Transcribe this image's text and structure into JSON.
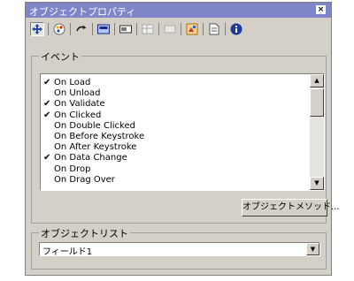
{
  "window": {
    "title": "オブジェクトプロパティ",
    "close_glyph": "×"
  },
  "toolbar": {
    "icons": [
      {
        "name": "move-arrows-icon",
        "active": true
      },
      {
        "name": "color-palette-icon"
      },
      {
        "name": "curved-arrow-icon"
      },
      {
        "name": "picture-icon"
      },
      {
        "name": "text-field-icon"
      },
      {
        "name": "table-icon"
      },
      {
        "name": "rectangle-icon"
      },
      {
        "name": "image-icon"
      },
      {
        "name": "page-icon"
      },
      {
        "name": "info-icon"
      }
    ]
  },
  "events": {
    "group_label": "イベント",
    "items": [
      {
        "label": "On Load",
        "checked": true
      },
      {
        "label": "On Unload",
        "checked": false
      },
      {
        "label": "On Validate",
        "checked": true
      },
      {
        "label": "On Clicked",
        "checked": true
      },
      {
        "label": "On Double Clicked",
        "checked": false
      },
      {
        "label": "On Before Keystroke",
        "checked": false
      },
      {
        "label": "On After Keystroke",
        "checked": false
      },
      {
        "label": "On Data Change",
        "checked": true
      },
      {
        "label": "On Drop",
        "checked": false
      },
      {
        "label": "On Drag Over",
        "checked": false
      }
    ],
    "check_glyph": "✔",
    "method_button": "オブジェクトメソッド..."
  },
  "object_list": {
    "group_label": "オブジェクトリスト",
    "selected": "フィールド1"
  },
  "scroll_glyphs": {
    "up": "▲",
    "down": "▼"
  }
}
